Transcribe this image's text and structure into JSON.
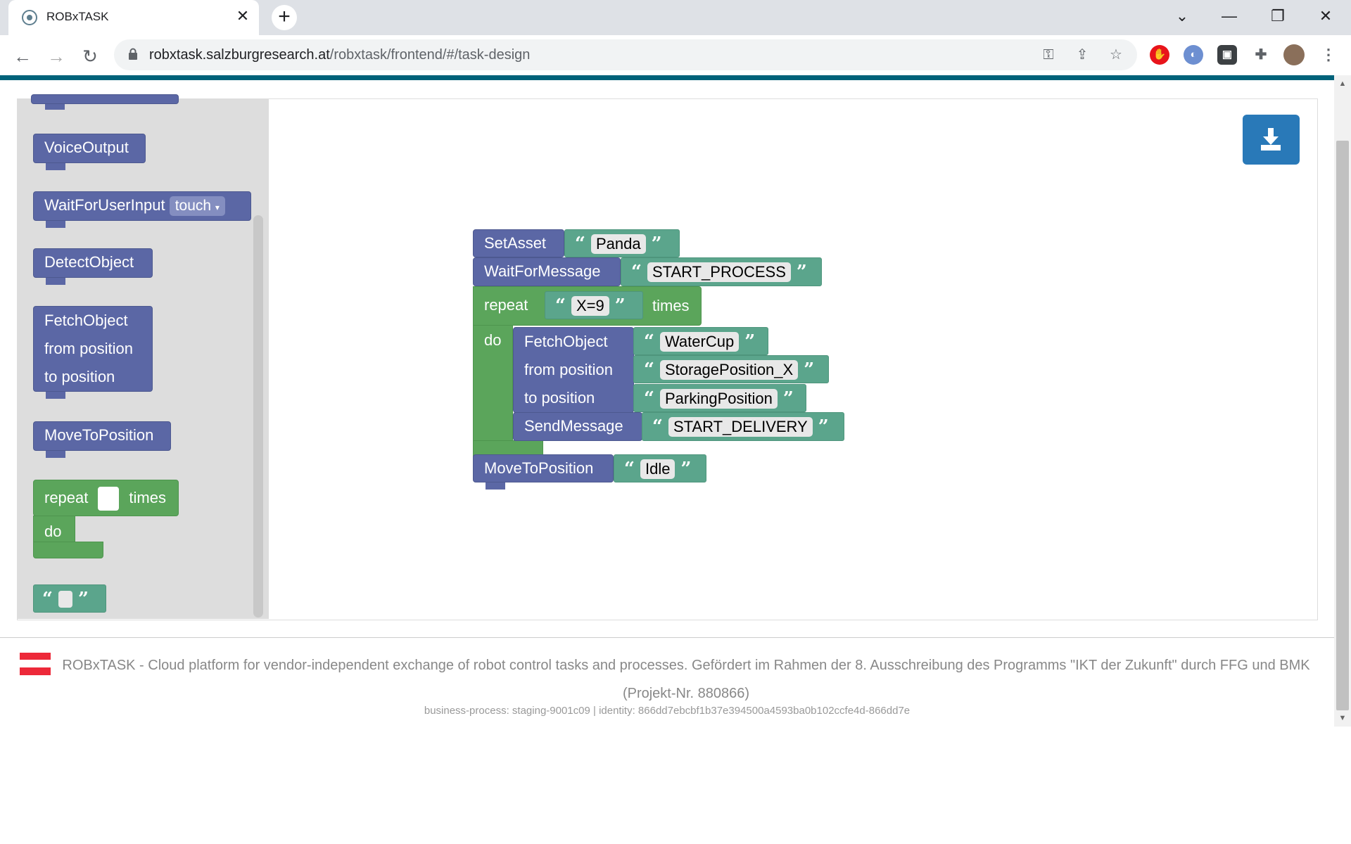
{
  "browser": {
    "tab_title": "ROBxTASK",
    "url_host": "robxtask.salzburgresearch.at",
    "url_path": "/robxtask/frontend/#/task-design"
  },
  "flyout": {
    "voice_output": "VoiceOutput",
    "wait_for_user_input": "WaitForUserInput",
    "wait_for_user_input_option": "touch",
    "detect_object": "DetectObject",
    "fetch_object": "FetchObject",
    "from_position": "from position",
    "to_position": "to position",
    "move_to_position": "MoveToPosition",
    "repeat": "repeat",
    "times": "times",
    "do": "do"
  },
  "program": {
    "set_asset": {
      "label": "SetAsset",
      "value": "Panda"
    },
    "wait_for_message": {
      "label": "WaitForMessage",
      "value": "START_PROCESS"
    },
    "repeat": {
      "label": "repeat",
      "value": "X=9",
      "times": "times",
      "do": "do"
    },
    "fetch_object": {
      "label": "FetchObject",
      "value": "WaterCup",
      "from_label": "from position",
      "from_value": "StoragePosition_X",
      "to_label": "to position",
      "to_value": "ParkingPosition"
    },
    "send_message": {
      "label": "SendMessage",
      "value": "START_DELIVERY"
    },
    "move_to_position": {
      "label": "MoveToPosition",
      "value": "Idle"
    }
  },
  "quote_open": "“",
  "quote_close": "”",
  "footer": {
    "text": "ROBxTASK - Cloud platform for vendor-independent exchange of robot control tasks and processes. Gefördert im Rahmen der 8. Ausschreibung des Programms \"IKT der Zukunft\" durch FFG und BMK (Projekt-Nr. 880866)",
    "meta": "business-process: staging-9001c09 | identity: 866dd7ebcbf1b37e394500a4593ba0b102ccfe4d-866dd7e"
  },
  "colors": {
    "accent": "#00627a",
    "block_purple": "#5b67a5",
    "block_green": "#5ba55b",
    "block_teal": "#5ba58c",
    "download": "#2979b8"
  }
}
